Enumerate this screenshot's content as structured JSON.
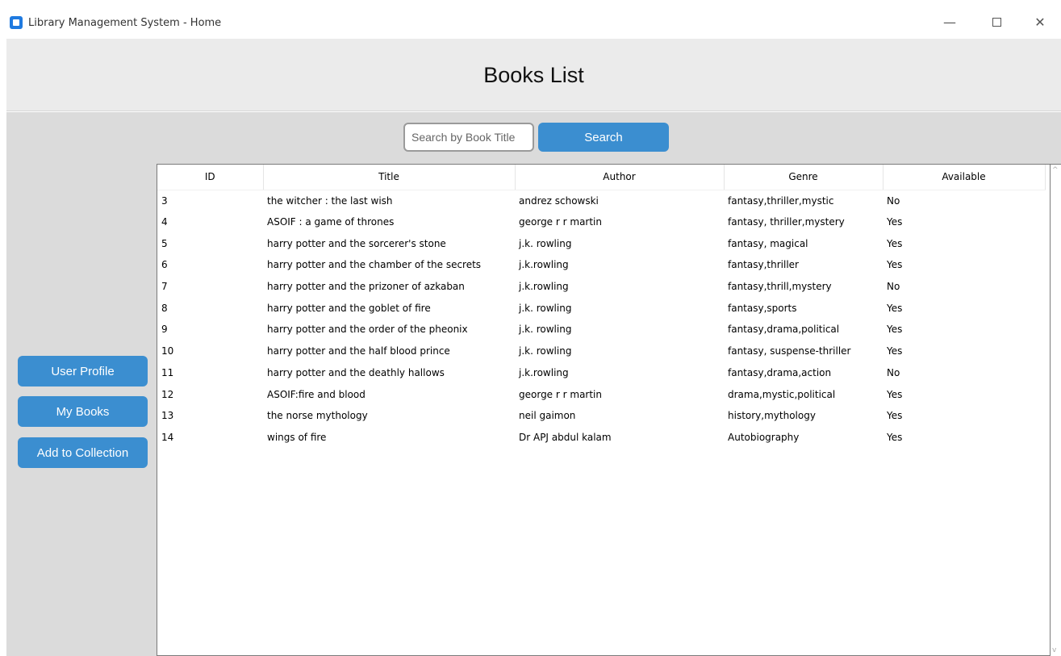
{
  "window": {
    "title": "Library Management System - Home",
    "minimize": "—",
    "close": "✕"
  },
  "header": {
    "title": "Books List"
  },
  "search": {
    "placeholder": "Search by Book Title",
    "button_label": "Search"
  },
  "sidebar": {
    "user_profile": "User Profile",
    "my_books": "My Books",
    "add_to_collection": "Add to Collection"
  },
  "table": {
    "columns": [
      "ID",
      "Title",
      "Author",
      "Genre",
      "Available"
    ],
    "rows": [
      [
        "3",
        "the witcher : the last wish",
        "andrez schowski",
        "fantasy,thriller,mystic",
        "No"
      ],
      [
        "4",
        "ASOIF : a game of thrones",
        "george r r martin",
        "fantasy, thriller,mystery",
        "Yes"
      ],
      [
        "5",
        "harry potter and the sorcerer's stone",
        "j.k. rowling",
        "fantasy, magical",
        "Yes"
      ],
      [
        "6",
        "harry potter and the chamber of the secrets",
        "j.k.rowling",
        "fantasy,thriller",
        "Yes"
      ],
      [
        "7",
        "harry potter and the prizoner of azkaban",
        "j.k.rowling",
        "fantasy,thrill,mystery",
        "No"
      ],
      [
        "8",
        "harry potter and the goblet of fire",
        "j.k. rowling",
        "fantasy,sports",
        "Yes"
      ],
      [
        "9",
        "harry potter and the order of the pheonix",
        "j.k. rowling",
        "fantasy,drama,political",
        "Yes"
      ],
      [
        "10",
        "harry potter and the half blood prince",
        "j.k. rowling",
        "fantasy, suspense-thriller",
        "Yes"
      ],
      [
        "11",
        "harry potter and the deathly hallows",
        "j.k.rowling",
        "fantasy,drama,action",
        "No"
      ],
      [
        "12",
        "ASOIF:fire and blood",
        "george r r martin",
        "drama,mystic,political",
        "Yes"
      ],
      [
        "13",
        "the norse mythology",
        "neil gaimon",
        "history,mythology",
        "Yes"
      ],
      [
        "14",
        "wings of fire",
        "Dr APJ abdul kalam",
        "Autobiography",
        "Yes"
      ]
    ]
  },
  "colors": {
    "accent": "#3b8ed0",
    "header_bg": "#ebebeb",
    "content_bg": "#dbdbdb"
  }
}
